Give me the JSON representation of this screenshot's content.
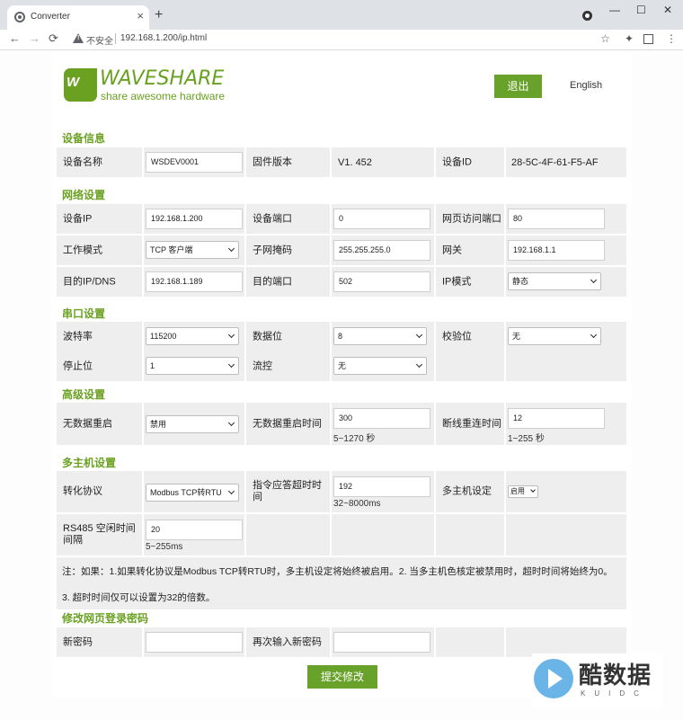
{
  "browser": {
    "tab_title": "Converter",
    "tab_close": "×",
    "new_tab": "+",
    "minimize": "—",
    "maximize": "☐",
    "close": "✕",
    "back": "←",
    "forward": "→",
    "reload": "⟳",
    "insecure_label": "不安全",
    "url": "192.168.1.200/ip.html",
    "star_icon": "☆",
    "ext_icon": "✦",
    "menu_icon": "⋮"
  },
  "header": {
    "logo_name": "WAVESHARE",
    "logo_mark": "W",
    "logo_tagline": "share awesome hardware",
    "logout": "退出",
    "language": "English"
  },
  "device_info": {
    "title": "设备信息",
    "name_label": "设备名称",
    "name_value": "WSDEV0001",
    "fw_label": "固件版本",
    "fw_value": "V1. 452",
    "id_label": "设备ID",
    "id_value": "28-5C-4F-61-F5-AF"
  },
  "network": {
    "title": "网络设置",
    "ip_label": "设备IP",
    "ip_value": "192.168.1.200",
    "port_label": "设备端口",
    "port_value": "0",
    "web_port_label": "网页访问端口",
    "web_port_value": "80",
    "mode_label": "工作模式",
    "mode_value": "TCP 客户端",
    "mask_label": "子网掩码",
    "mask_value": "255.255.255.0",
    "gw_label": "网关",
    "gw_value": "192.168.1.1",
    "dst_ip_label": "目的IP/DNS",
    "dst_ip_value": "192.168.1.189",
    "dst_port_label": "目的端口",
    "dst_port_value": "502",
    "ip_mode_label": "IP模式",
    "ip_mode_value": "静态"
  },
  "serial": {
    "title": "串口设置",
    "baud_label": "波特率",
    "baud_value": "115200",
    "data_label": "数据位",
    "data_value": "8",
    "parity_label": "校验位",
    "parity_value": "无",
    "stop_label": "停止位",
    "stop_value": "1",
    "flow_label": "流控",
    "flow_value": "无"
  },
  "advanced": {
    "title": "高级设置",
    "restart_label": "无数据重启",
    "restart_value": "禁用",
    "restart_time_label": "无数据重启时间",
    "restart_time_value": "300",
    "restart_time_hint": "5~1270 秒",
    "reconnect_label": "断线重连时间",
    "reconnect_value": "12",
    "reconnect_hint": "1~255 秒"
  },
  "multihost": {
    "title": "多主机设置",
    "protocol_label": "转化协议",
    "protocol_value": "Modbus TCP转RTU",
    "timeout_label": "指令应答超时时间",
    "timeout_value": "192",
    "timeout_hint": "32~8000ms",
    "mode_label": "多主机设定",
    "mode_value": "启用",
    "idle_label": "RS485 空闲时间间隔",
    "idle_value": "20",
    "idle_hint": "5~255ms",
    "note1": "注：如果：1.如果转化协议是Modbus TCP转RTU时，多主机设定将始终被启用。2. 当多主机色核定被禁用时，超时时间将始终为0。",
    "note2": "3. 超时时间仅可以设置为32的倍数。"
  },
  "password": {
    "title": "修改网页登录密码",
    "new_label": "新密码",
    "new_value": "",
    "confirm_label": "再次输入新密码",
    "confirm_value": ""
  },
  "submit_label": "提交修改",
  "watermark": {
    "text": "酷数据",
    "sub": "KUIDC"
  },
  "colors": {
    "brand_green": "#69a22a",
    "cell_bg": "#eeeeee"
  }
}
